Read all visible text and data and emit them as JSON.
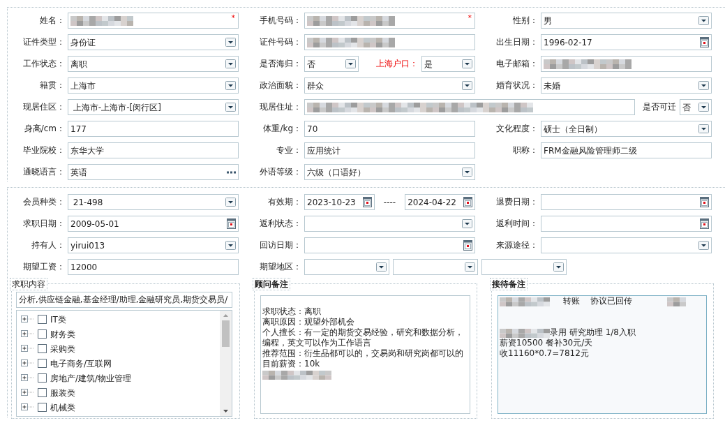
{
  "sections": [
    {
      "rows": [
        [
          {
            "label": "姓名：",
            "items": [
              {
                "kind": "text",
                "redacted": true,
                "required_mark": "*"
              }
            ]
          },
          {
            "label": "手机号码：",
            "items": [
              {
                "kind": "text",
                "redacted": true,
                "required_mark": "*"
              }
            ]
          },
          {
            "label": "性别：",
            "items": [
              {
                "kind": "select",
                "value": "男"
              }
            ]
          }
        ],
        [
          {
            "label": "证件类型：",
            "items": [
              {
                "kind": "select",
                "value": "身份证"
              }
            ]
          },
          {
            "label": "证件号码：",
            "items": [
              {
                "kind": "text",
                "redacted": true
              }
            ]
          },
          {
            "label": "出生日期：",
            "items": [
              {
                "kind": "date",
                "value": "1996-02-17"
              }
            ]
          }
        ],
        [
          {
            "label": "工作状态：",
            "items": [
              {
                "kind": "select",
                "value": "离职"
              }
            ]
          },
          {
            "label": "是否海归：",
            "items": [
              {
                "kind": "select",
                "value": "否"
              },
              {
                "kind": "label",
                "text": "上海户口：",
                "highlight": true
              },
              {
                "kind": "select",
                "value": "是"
              }
            ]
          },
          {
            "label": "电子邮箱：",
            "items": [
              {
                "kind": "text",
                "redacted": true
              }
            ]
          }
        ],
        [
          {
            "label": "籍贯：",
            "items": [
              {
                "kind": "select",
                "value": "上海市"
              }
            ]
          },
          {
            "label": "政治面貌：",
            "items": [
              {
                "kind": "select",
                "value": "群众"
              }
            ]
          },
          {
            "label": "婚育状况：",
            "items": [
              {
                "kind": "select",
                "value": "未婚"
              }
            ]
          }
        ],
        [
          {
            "label": "现居住区：",
            "items": [
              {
                "kind": "select",
                "value": " 上海市-上海市-[闵行区]"
              }
            ]
          },
          {
            "label": "现居住址：",
            "spans_columns": true,
            "items": [
              {
                "kind": "text",
                "redacted": true
              },
              {
                "kind": "label",
                "text": "是否可迁",
                "highlight": false
              },
              {
                "kind": "select",
                "value": "否"
              }
            ]
          }
        ],
        [
          {
            "label": "身高/cm：",
            "items": [
              {
                "kind": "text",
                "value": "177"
              }
            ]
          },
          {
            "label": "体重/kg：",
            "items": [
              {
                "kind": "text",
                "value": "70"
              }
            ]
          },
          {
            "label": "文化程度：",
            "items": [
              {
                "kind": "select",
                "value": "硕士（全日制）"
              }
            ]
          }
        ],
        [
          {
            "label": "毕业院校：",
            "items": [
              {
                "kind": "text",
                "value": "东华大学"
              }
            ]
          },
          {
            "label": "专业：",
            "items": [
              {
                "kind": "text",
                "value": "应用统计"
              }
            ]
          },
          {
            "label": "职称：",
            "items": [
              {
                "kind": "text",
                "value": "FRM金融风险管理师二级"
              }
            ]
          }
        ],
        [
          {
            "label": "通晓语言：",
            "items": [
              {
                "kind": "lookup",
                "value": "英语"
              }
            ]
          },
          {
            "label": "外语等级：",
            "items": [
              {
                "kind": "select",
                "value": "六级（口语好）"
              }
            ]
          }
        ]
      ]
    },
    {
      "rows": [
        [
          {
            "label": "会员种类：",
            "items": [
              {
                "kind": "select",
                "value": " 21-498"
              }
            ]
          },
          {
            "label": "有效期：",
            "items": [
              {
                "kind": "date",
                "value": "2023-10-23"
              },
              {
                "kind": "separator",
                "text": "----"
              },
              {
                "kind": "date",
                "value": "2024-04-22"
              }
            ]
          },
          {
            "label": "退费日期：",
            "items": [
              {
                "kind": "date"
              }
            ]
          }
        ],
        [
          {
            "label": "求职日期：",
            "items": [
              {
                "kind": "date",
                "value": "2009-05-01"
              }
            ]
          },
          {
            "label": "返利状态：",
            "items": [
              {
                "kind": "select"
              }
            ]
          },
          {
            "label": "返利时间：",
            "items": [
              {
                "kind": "date"
              }
            ]
          }
        ],
        [
          {
            "label": "持有人：",
            "items": [
              {
                "kind": "select",
                "value": "yirui013"
              }
            ]
          },
          {
            "label": "回访日期：",
            "items": [
              {
                "kind": "date"
              }
            ]
          },
          {
            "label": "来源途径：",
            "items": [
              {
                "kind": "select"
              }
            ]
          }
        ],
        [
          {
            "label": "期望工资：",
            "items": [
              {
                "kind": "text",
                "value": "12000"
              }
            ]
          },
          {
            "label": "期望地区：",
            "spans_columns": true,
            "items": [
              {
                "kind": "select"
              },
              {
                "kind": "select"
              },
              {
                "kind": "select"
              }
            ]
          }
        ]
      ]
    }
  ],
  "panels": [
    {
      "kind": "tree",
      "title": "求职内容",
      "emphasized": false,
      "summary": "分析,供应链金融,基金经理/助理,金融研究员,期货交易员/",
      "tree_items": [
        {
          "label": "IT类",
          "expanded": false,
          "checked": false
        },
        {
          "label": "财务类",
          "expanded": false,
          "checked": false
        },
        {
          "label": "采购类",
          "expanded": false,
          "checked": false
        },
        {
          "label": "电子商务/互联网",
          "expanded": false,
          "checked": false
        },
        {
          "label": "房地产/建筑/物业管理",
          "expanded": false,
          "checked": false
        },
        {
          "label": "服装类",
          "expanded": false,
          "checked": false
        },
        {
          "label": "机械类",
          "expanded": false,
          "checked": false
        }
      ]
    },
    {
      "kind": "notes",
      "title": "顾问备注",
      "emphasized": true,
      "tinted": false,
      "lines": [
        {
          "text": "求职状态：离职",
          "blank_line_before": true
        },
        {
          "text": "离职原因：观望外部机会"
        },
        {
          "text": "个人擅长：有一定的期货交易经验，研究和数据分析，编程，英文可以作为工作语言"
        },
        {
          "text": "推荐范围：衍生品都可以的，交易岗和研究岗都可以的"
        },
        {
          "text": "目前薪资：10k"
        },
        {
          "redacted_before": true
        }
      ]
    },
    {
      "kind": "notes",
      "title": "接待备注",
      "emphasized": true,
      "tinted": true,
      "lines": [
        {
          "text": "     转账    协议已回传",
          "redacted_before": true,
          "redacted_after": true
        },
        {
          "text": "录用 研究助理 1/8入职",
          "redacted_before": true,
          "blank_line_before": true,
          "extra_blank_line": true
        },
        {
          "text": "薪资10500 餐补30元/天"
        },
        {
          "text": "收11160*0.7=7812元"
        }
      ]
    }
  ]
}
